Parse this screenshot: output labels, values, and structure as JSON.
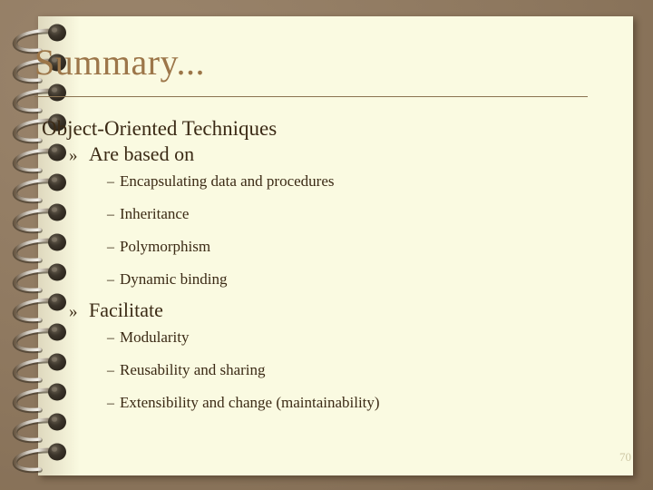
{
  "slide": {
    "title": "Summary...",
    "page_number": "70",
    "colors": {
      "background": "#8d775e",
      "paper": "#fafae1",
      "title": "#9c7649",
      "body_text": "#3b2a15",
      "rule": "#8a7351",
      "page_number": "#cdc7a4"
    },
    "icons": {
      "spiral_binding": "spiral-binding-icon"
    }
  },
  "content": {
    "heading": "Object-Oriented Techniques",
    "sections": [
      {
        "bullet": "»",
        "label": "Are based on",
        "items": [
          {
            "bullet": "–",
            "text": "Encapsulating data and procedures"
          },
          {
            "bullet": "–",
            "text": "Inheritance"
          },
          {
            "bullet": "–",
            "text": "Polymorphism"
          },
          {
            "bullet": "–",
            "text": "Dynamic binding"
          }
        ]
      },
      {
        "bullet": "»",
        "label": "Facilitate",
        "items": [
          {
            "bullet": "–",
            "text": "Modularity"
          },
          {
            "bullet": "–",
            "text": "Reusability and sharing"
          },
          {
            "bullet": "–",
            "text": "Extensibility and change (maintainability)"
          }
        ]
      }
    ]
  }
}
